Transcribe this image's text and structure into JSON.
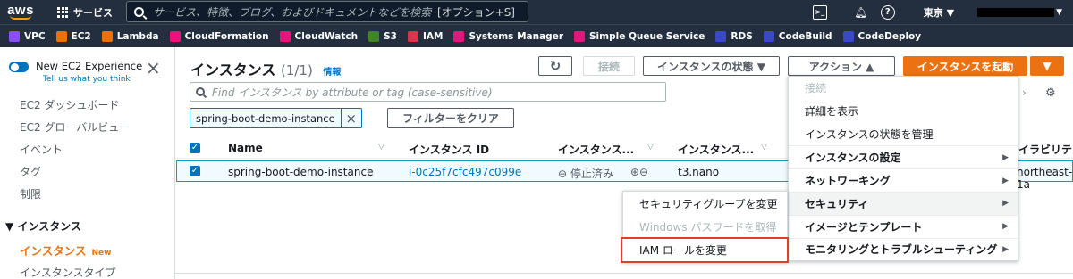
{
  "topnav": {
    "logo": "aws",
    "services": "サービス",
    "search_placeholder": "サービス、特徴、ブログ、およびドキュメントなどを検索",
    "search_shortcut": "[オプション+S]",
    "region": "東京 ▼",
    "icons": [
      "cloudshell-icon",
      "bell-icon",
      "help-icon"
    ]
  },
  "favorites": [
    {
      "label": "VPC",
      "color": "#8c4fff"
    },
    {
      "label": "EC2",
      "color": "#ed7100"
    },
    {
      "label": "Lambda",
      "color": "#ed7100"
    },
    {
      "label": "CloudFormation",
      "color": "#e7157b"
    },
    {
      "label": "CloudWatch",
      "color": "#e7157b"
    },
    {
      "label": "S3",
      "color": "#3f8624"
    },
    {
      "label": "IAM",
      "color": "#dd344c"
    },
    {
      "label": "Systems Manager",
      "color": "#e7157b"
    },
    {
      "label": "Simple Queue Service",
      "color": "#e7157b"
    },
    {
      "label": "RDS",
      "color": "#3b48cc"
    },
    {
      "label": "CodeBuild",
      "color": "#3b48cc"
    },
    {
      "label": "CodeDeploy",
      "color": "#3b48cc"
    }
  ],
  "sidebar": {
    "new_experience": "New EC2 Experience",
    "tell_us": "Tell us what you think",
    "items": [
      "EC2 ダッシュボード",
      "EC2 グローバルビュー",
      "イベント",
      "タグ",
      "制限"
    ],
    "section": "▼ インスタンス",
    "active": "インスタンス",
    "active_badge": "New",
    "sub_item": "インスタンスタイプ"
  },
  "main": {
    "title": "インスタンス",
    "count": "(1/1)",
    "info": "情報",
    "buttons": {
      "connect": "接続",
      "state": "インスタンスの状態 ▼",
      "actions": "アクション ▲",
      "launch": "インスタンスを起動",
      "launch_caret": "▼"
    },
    "filter_placeholder": "Find インスタンス by attribute or tag (case-sensitive)",
    "token": "spring-boot-demo-instance",
    "clear_filters": "フィルターをクリア",
    "columns": [
      "Name",
      "インスタンス ID",
      "インスタンス...",
      "インスタンス...",
      "イラビリテ"
    ],
    "row": {
      "name": "spring-boot-demo-instance",
      "id": "i-0c25f7cfc497c099e",
      "state": "⊖ 停止済み",
      "zoom": "⊕⊖",
      "type": "t3.nano",
      "az": "northeast-1a"
    }
  },
  "actions_menu": [
    {
      "label": "接続",
      "disabled": true
    },
    {
      "label": "詳細を表示"
    },
    {
      "label": "インスタンスの状態を管理"
    },
    {
      "label": "インスタンスの設定",
      "submenu": true,
      "bold": true
    },
    {
      "label": "ネットワーキング",
      "submenu": true,
      "bold": true
    },
    {
      "label": "セキュリティ",
      "submenu": true,
      "bold": true,
      "highlighted": true
    },
    {
      "label": "イメージとテンプレート",
      "submenu": true,
      "bold": true
    },
    {
      "label": "モニタリングとトラブルシューティング",
      "submenu": true,
      "bold": true
    }
  ],
  "security_submenu": [
    {
      "label": "セキュリティグループを変更"
    },
    {
      "label": "Windows パスワードを取得",
      "disabled": true
    },
    {
      "label": "IAM ロールを変更",
      "boxed": true
    }
  ]
}
